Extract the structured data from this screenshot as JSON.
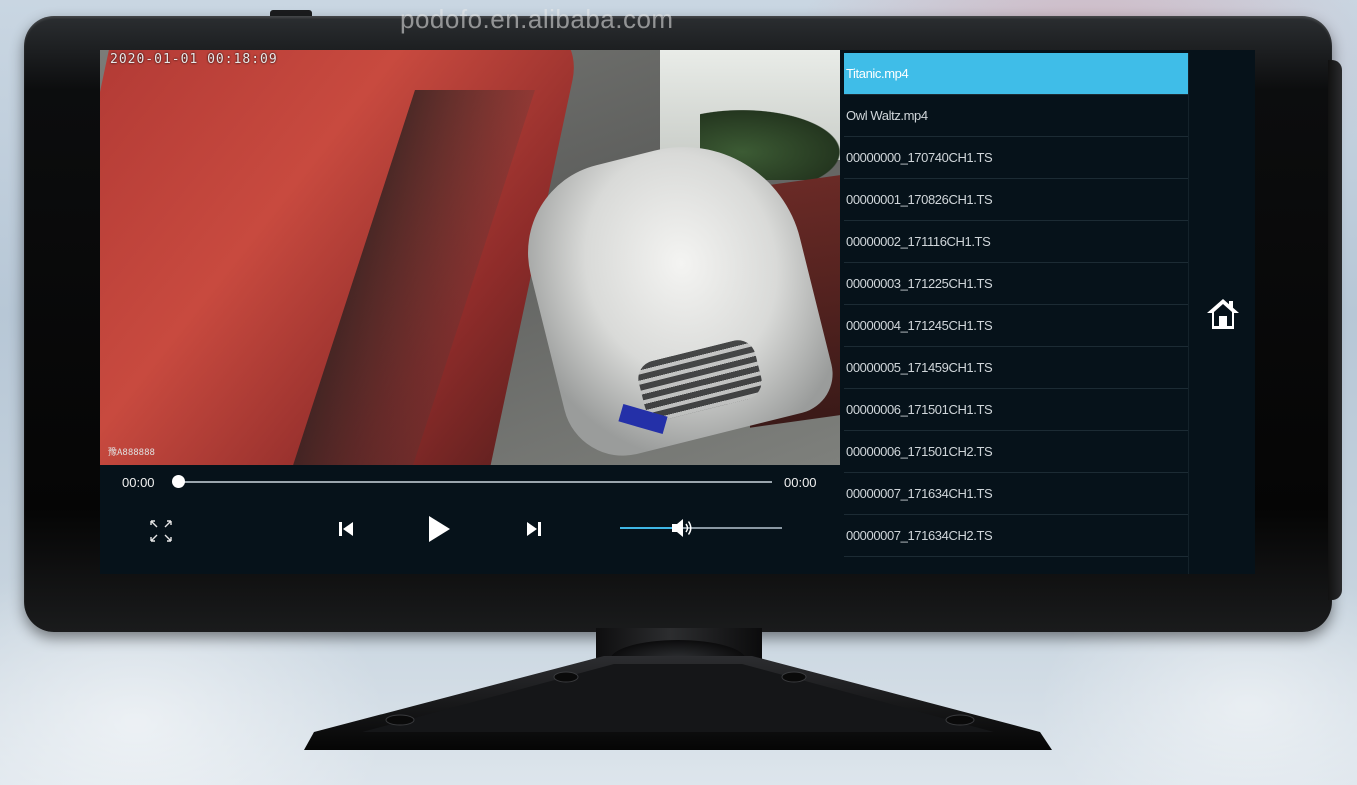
{
  "watermark": "podofo.en.alibaba.com",
  "video": {
    "osd_timestamp": "2020-01-01 00:18:09",
    "osd_plate": "豫A888888"
  },
  "controls": {
    "current_time": "00:00",
    "duration": "00:00",
    "seek_progress": 0.0,
    "volume_level": 0.33,
    "icons": {
      "fullscreen": "expand-arrows-icon",
      "prev": "skip-previous-icon",
      "play": "play-icon",
      "next": "skip-next-icon",
      "volume": "speaker-icon",
      "home": "home-icon"
    }
  },
  "playlist": {
    "selected_index": 0,
    "items": [
      "Titanic.mp4",
      "Owl Waltz.mp4",
      "00000000_170740CH1.TS",
      "00000001_170826CH1.TS",
      "00000002_171116CH1.TS",
      "00000003_171225CH1.TS",
      "00000004_171245CH1.TS",
      "00000005_171459CH1.TS",
      "00000006_171501CH1.TS",
      "00000006_171501CH2.TS",
      "00000007_171634CH1.TS",
      "00000007_171634CH2.TS"
    ]
  },
  "colors": {
    "accent": "#3fbde8",
    "screen_bg": "#06121a",
    "bezel": "#0a0b0c"
  }
}
